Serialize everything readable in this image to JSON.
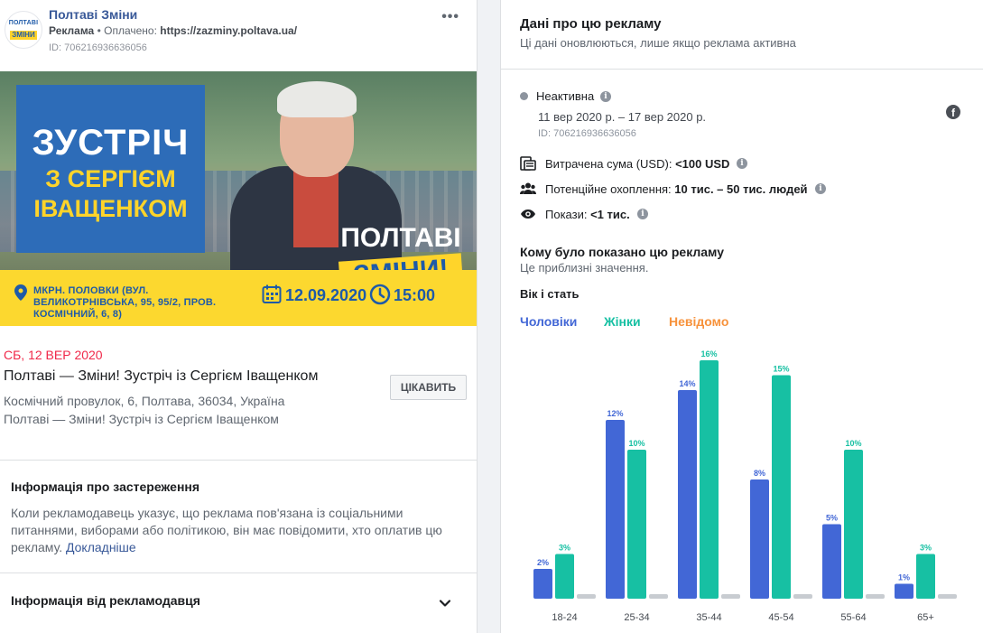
{
  "ad": {
    "page_name": "Полтаві Зміни",
    "avatar_logo_line1": "ПОЛТАВІ",
    "avatar_logo_line2": "ЗМІНИ",
    "sponsored_label": "Реклама",
    "paid_prefix": "• Оплачено:",
    "paid_by": "https://zazminy.poltava.ua/",
    "id_text": "ID: 706216936636056"
  },
  "banner": {
    "headline1": "ЗУСТРІЧ",
    "headline2": "З СЕРГІЄМ",
    "headline3": "ІВАЩЕНКОМ",
    "logo_line1": "ПОЛТАВІ",
    "logo_line2": "ЗМІНИ!",
    "address": "МКРН. ПОЛОВКИ (ВУЛ. ВЕЛИКОТРНІВСЬКА, 95, 95/2, ПРОВ. КОСМІЧНИЙ, 6, 8)",
    "date": "12.09.2020",
    "time": "15:00"
  },
  "event": {
    "date": "СБ, 12 ВЕР 2020",
    "title": "Полтаві — Зміни! Зустріч із Сергієм Іващенком",
    "location": "Космічний провулок, 6, Полтава, 36034, Україна",
    "subtitle": "Полтаві — Зміни! Зустріч із Сергієм Іващенком",
    "interest_button": "ЦІКАВИТЬ"
  },
  "disclaimer": {
    "title": "Інформація про застереження",
    "text": "Коли рекламодавець указує, що реклама пов'язана із соціальними питаннями, виборами або політикою, він має повідомити, хто оплатив цю рекламу.",
    "link": "Докладніше"
  },
  "advertiser": {
    "title": "Інформація від рекламодавця"
  },
  "about": {
    "title": "Дані про цю рекламу",
    "subtitle": "Ці дані оновлюються, лише якщо реклама активна",
    "status": "Неактивна",
    "dates": "11 вер 2020 р. – 17 вер 2020 р.",
    "id_text": "ID: 706216936636056",
    "fb_icon_glyph": "f",
    "info_glyph": "i",
    "spend_label": "Витрачена сума (USD):",
    "spend_value": "<100 USD",
    "reach_label": "Потенційне охоплення:",
    "reach_value": "10 тис. – 50 тис. людей",
    "impressions_label": "Покази:",
    "impressions_value": "<1 тис."
  },
  "audience": {
    "title": "Кому було показано цю рекламу",
    "subtitle": "Це приблизні значення.",
    "age_gender_title": "Вік і стать",
    "legend": [
      {
        "label": "Чоловіки",
        "color": "#4267d6"
      },
      {
        "label": "Жінки",
        "color": "#17c0a3"
      },
      {
        "label": "Невідомо",
        "color": "#f7923b"
      }
    ]
  },
  "colors": {
    "men": "#4267d6",
    "women": "#17c0a3",
    "unknown": "#c8ccd1"
  },
  "chart_data": {
    "type": "bar",
    "categories": [
      "18-24",
      "25-34",
      "35-44",
      "45-54",
      "55-64",
      "65+"
    ],
    "series": [
      {
        "name": "Чоловіки",
        "values": [
          2,
          12,
          14,
          8,
          5,
          1
        ],
        "labels": [
          "2%",
          "12%",
          "14%",
          "8%",
          "5%",
          "1%"
        ]
      },
      {
        "name": "Жінки",
        "values": [
          3,
          10,
          16,
          15,
          10,
          3
        ],
        "labels": [
          "3%",
          "10%",
          "16%",
          "15%",
          "10%",
          "3%"
        ]
      },
      {
        "name": "Невідомо",
        "values": [
          0,
          0,
          0,
          0,
          0,
          0
        ],
        "labels": [
          "",
          "",
          "",
          "",
          "",
          ""
        ]
      }
    ],
    "ylim": [
      0,
      16
    ]
  }
}
